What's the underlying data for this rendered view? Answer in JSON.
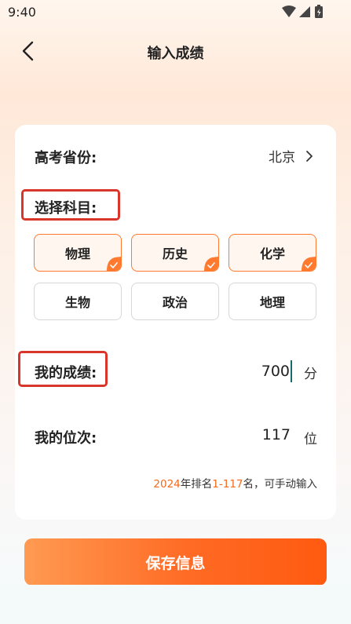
{
  "status_bar": {
    "time": "9:40"
  },
  "nav": {
    "title": "输入成绩"
  },
  "province": {
    "label": "高考省份:",
    "value": "北京"
  },
  "subjects": {
    "label": "选择科目:",
    "items": [
      {
        "name": "物理",
        "selected": true
      },
      {
        "name": "历史",
        "selected": true
      },
      {
        "name": "化学",
        "selected": true
      },
      {
        "name": "生物",
        "selected": false
      },
      {
        "name": "政治",
        "selected": false
      },
      {
        "name": "地理",
        "selected": false
      }
    ]
  },
  "score": {
    "label": "我的成绩:",
    "value": "700",
    "unit": "分"
  },
  "rank": {
    "label": "我的位次:",
    "value": "117",
    "unit": "位",
    "hint_year": "2024",
    "hint_text1": "年排名",
    "hint_range": "1-117",
    "hint_text2": "名，可手动输入"
  },
  "save_button": {
    "label": "保存信息"
  },
  "colors": {
    "accent": "#ff6a24",
    "highlight_border": "#d8362b",
    "selected_bg": "#fff6ef"
  }
}
